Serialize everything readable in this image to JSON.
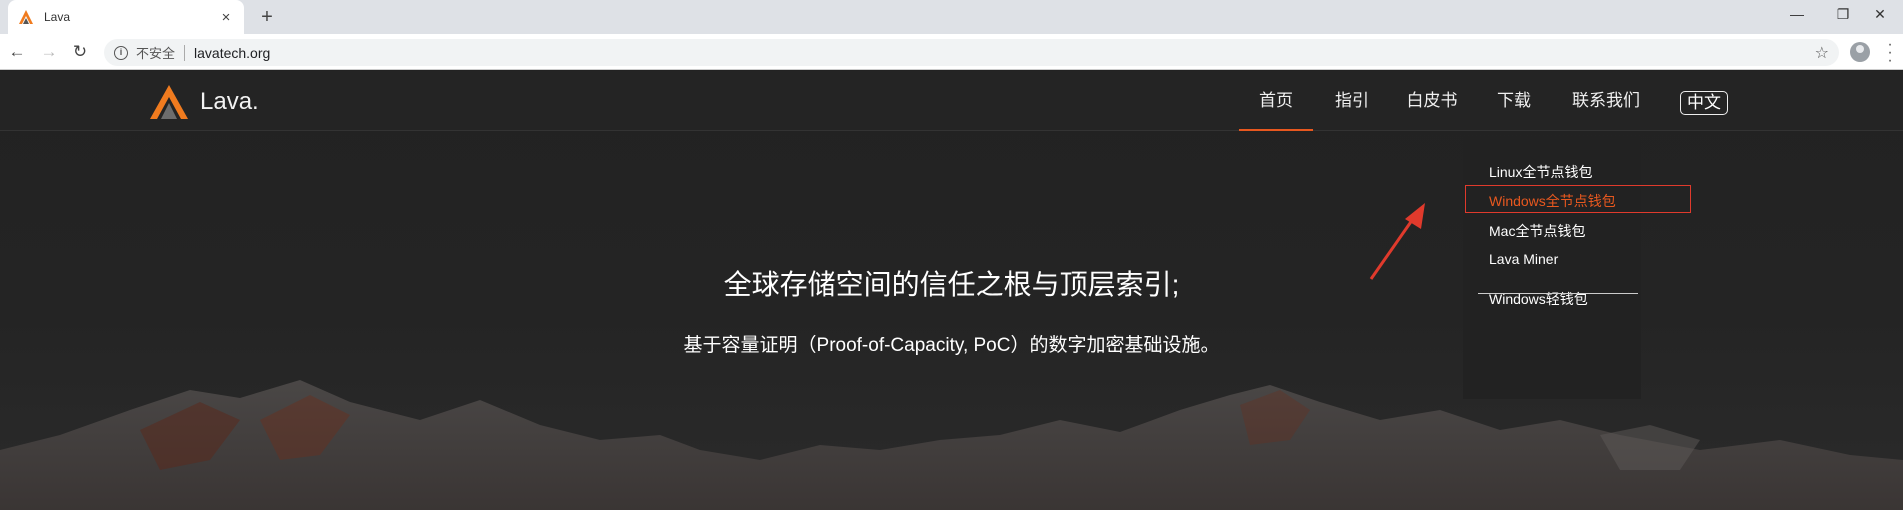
{
  "browser": {
    "tab_title": "Lava",
    "tab_close_icon": "×",
    "new_tab_icon": "+",
    "back_icon": "←",
    "forward_icon": "→",
    "reload_icon": "↻",
    "insecure_label": "不安全",
    "url": "lavatech.org",
    "bookmark_icon": "☆",
    "minimize_icon": "—",
    "restore_icon": "❐",
    "close_icon": "✕"
  },
  "site": {
    "logo_text": "Lava.",
    "nav": [
      {
        "label": "首页",
        "active": true
      },
      {
        "label": "指引"
      },
      {
        "label": "白皮书"
      },
      {
        "label": "下载"
      },
      {
        "label": "联系我们"
      }
    ],
    "lang_button": "中文",
    "download_menu": [
      "Linux全节点钱包",
      "Windows全节点钱包",
      "Mac全节点钱包",
      "Lava Miner",
      "Windows轻钱包"
    ],
    "hero_title": "全球存储空间的信任之根与顶层索引;",
    "hero_subtitle": "基于容量证明（Proof-of-Capacity, PoC）的数字加密基础设施。"
  },
  "colors": {
    "accent": "#e8581f",
    "annotation": "#e03a2c",
    "header_bg": "#242424"
  }
}
